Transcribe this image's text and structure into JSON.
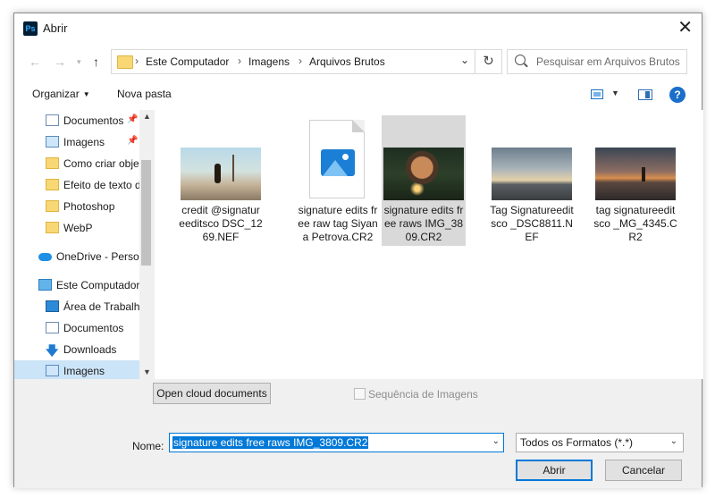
{
  "window": {
    "title": "Abrir",
    "app_icon": "Ps"
  },
  "address": {
    "crumbs": [
      "Este Computador",
      "Imagens",
      "Arquivos Brutos"
    ],
    "search_placeholder": "Pesquisar em Arquivos Brutos"
  },
  "toolbar": {
    "organize": "Organizar",
    "new_folder": "Nova pasta"
  },
  "sidebar": {
    "items": [
      {
        "label": "Documentos",
        "icon": "document-icon",
        "pinned": true
      },
      {
        "label": "Imagens",
        "icon": "pictures-icon",
        "pinned": true
      },
      {
        "label": "Como criar obje",
        "icon": "folder-icon"
      },
      {
        "label": "Efeito de texto d",
        "icon": "folder-icon"
      },
      {
        "label": "Photoshop",
        "icon": "folder-icon"
      },
      {
        "label": "WebP",
        "icon": "folder-icon"
      },
      {
        "label": "OneDrive - Persor",
        "icon": "onedrive-icon"
      },
      {
        "label": "Este Computador",
        "icon": "computer-icon"
      },
      {
        "label": "Área de Trabalho",
        "icon": "desktop-icon"
      },
      {
        "label": "Documentos",
        "icon": "document-icon"
      },
      {
        "label": "Downloads",
        "icon": "download-icon"
      },
      {
        "label": "Imagens",
        "icon": "pictures-icon",
        "selected": true
      }
    ]
  },
  "files": [
    {
      "name": "credit @signatureeditsco DSC_1269.NEF",
      "thumb": "photo-landscape-icon"
    },
    {
      "name": "signature edits free raw tag Siyana Petrova.CR2",
      "thumb": "image-file-icon"
    },
    {
      "name": "signature edits free raws IMG_3809.CR2",
      "thumb": "photo-sparkler-icon",
      "selected": true
    },
    {
      "name": "Tag Signatureeditsco _DSC8811.NEF",
      "thumb": "photo-city-icon"
    },
    {
      "name": "tag signatureeditsco _MG_4345.CR2",
      "thumb": "photo-sunset-icon"
    }
  ],
  "bottom": {
    "cloud_button": "Open cloud documents",
    "sequence_label": "Sequência de Imagens",
    "name_label": "Nome:",
    "name_value": "signature edits free raws IMG_3809.CR2",
    "format_value": "Todos os Formatos (*.*)",
    "open_button": "Abrir",
    "cancel_button": "Cancelar"
  },
  "colors": {
    "accent": "#0078d7",
    "selection": "#cce4f7",
    "folder": "#f8d775"
  }
}
